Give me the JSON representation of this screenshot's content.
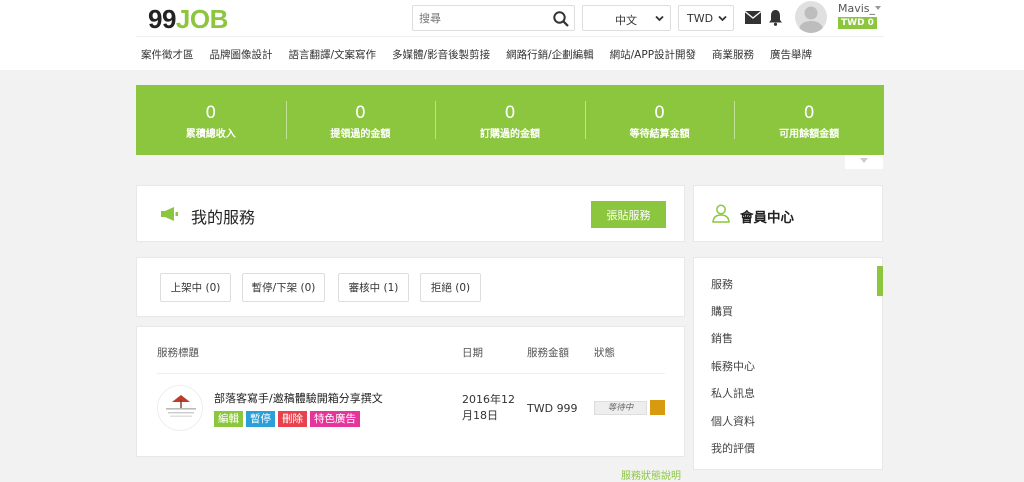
{
  "header": {
    "logo_num": "99",
    "logo_job": "JOB",
    "search_placeholder": "搜尋",
    "language": "中文",
    "currency": "TWD",
    "username": "Mavis_",
    "balance": "TWD 0"
  },
  "nav": [
    "案件徵才區",
    "品牌圖像設計",
    "語言翻譯/文案寫作",
    "多媒體/影音後製剪接",
    "網路行銷/企劃編輯",
    "網站/APP設計開發",
    "商業服務",
    "廣告舉牌"
  ],
  "stats": [
    {
      "value": "0",
      "label": "累積總收入"
    },
    {
      "value": "0",
      "label": "提領過的金額"
    },
    {
      "value": "0",
      "label": "訂購過的金額"
    },
    {
      "value": "0",
      "label": "等待結算金額"
    },
    {
      "value": "0",
      "label": "可用餘額金額"
    }
  ],
  "services": {
    "title": "我的服務",
    "post_button": "張貼服務",
    "filters": [
      "上架中 (0)",
      "暫停/下架 (0)",
      "審核中 (1)",
      "拒絕 (0)"
    ],
    "columns": [
      "服務標題",
      "日期",
      "服務金額",
      "狀態"
    ],
    "row": {
      "title": "部落客寫手/邀稿體驗開箱分享撰文",
      "tags": [
        {
          "label": "編輯",
          "color": "#8cc63f"
        },
        {
          "label": "暫停",
          "color": "#2a9fd8"
        },
        {
          "label": "刪除",
          "color": "#e8414d"
        },
        {
          "label": "特色廣告",
          "color": "#e6359a"
        }
      ],
      "date": "2016年12月18日",
      "price": "TWD 999",
      "status": "等待中",
      "status_color": "#d89a0e"
    },
    "status_help": "服務狀態說明"
  },
  "member": {
    "title": "會員中心",
    "menu": [
      "服務",
      "購買",
      "銷售",
      "帳務中心",
      "私人訊息",
      "個人資料",
      "我的評價"
    ]
  },
  "colors": {
    "accent": "#8cc63f"
  }
}
